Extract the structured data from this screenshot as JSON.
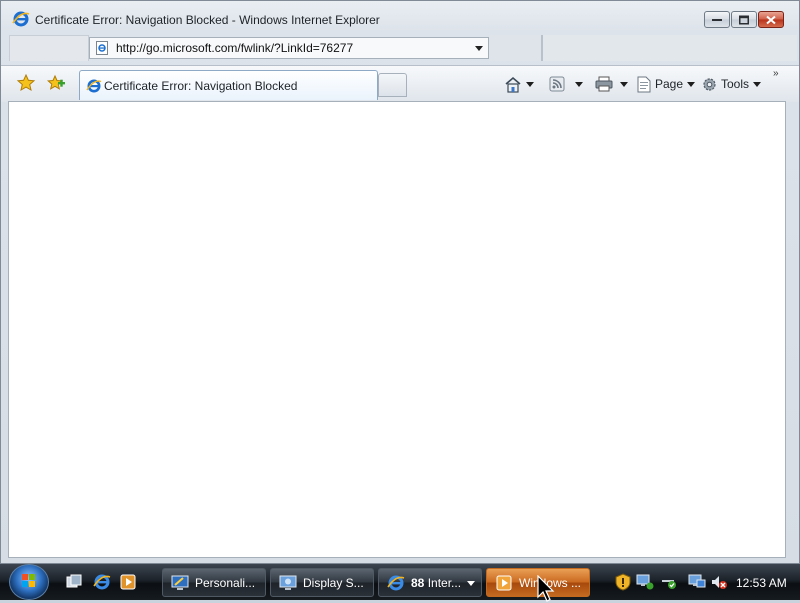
{
  "window": {
    "title": "Certificate Error: Navigation Blocked - Windows Internet Explorer"
  },
  "address_bar": {
    "url": "http://go.microsoft.com/fwlink/?LinkId=76277"
  },
  "tabs": [
    {
      "label": "Certificate Error: Navigation Blocked",
      "active": true
    }
  ],
  "command_bar": {
    "page_label": "Page",
    "tools_label": "Tools"
  },
  "taskbar": {
    "buttons": [
      {
        "label": "Personali...",
        "icon": "personalize-icon"
      },
      {
        "label": "Display S...",
        "icon": "display-settings-icon"
      },
      {
        "count": "88",
        "label": "Inter...",
        "icon": "ie-icon"
      },
      {
        "label": "Windows ...",
        "icon": "media-player-icon",
        "active": true
      }
    ],
    "clock": "12:53 AM"
  },
  "colors": {
    "active_task": "#c9681f",
    "taskbar": "#1c2229",
    "content_bg": "#ffffff"
  }
}
